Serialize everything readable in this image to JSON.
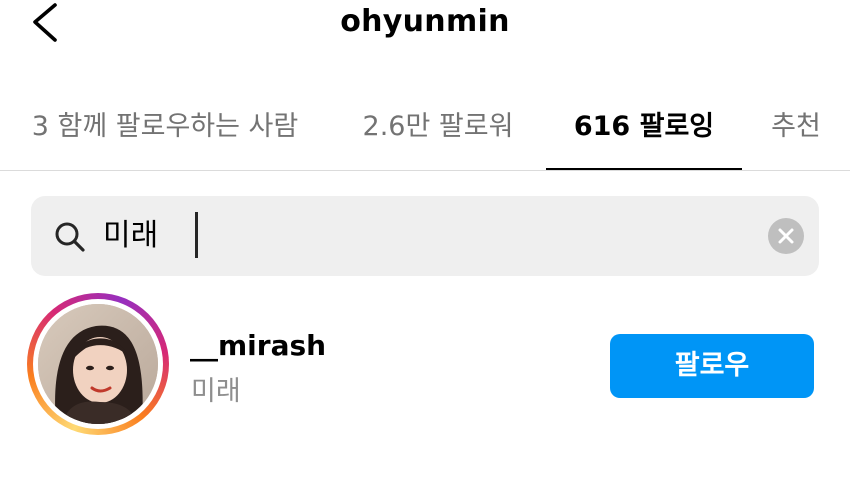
{
  "header": {
    "title": "ohyunmin",
    "back_icon": "chevron-left-icon"
  },
  "tabs": [
    {
      "label": "3 함께 팔로우하는 사람",
      "active": false
    },
    {
      "label": "2.6만 팔로워",
      "active": false
    },
    {
      "label": "616 팔로잉",
      "active": true
    },
    {
      "label": "추천",
      "active": false
    }
  ],
  "search": {
    "value": "미래",
    "icon": "search-icon",
    "clear_icon": "clear-icon"
  },
  "results": [
    {
      "username": "__mirash",
      "full_name": "미래",
      "action_label": "팔로우",
      "has_story": true
    }
  ],
  "colors": {
    "accent": "#0095f6",
    "tab_active": "#000000",
    "tab_inactive": "#737373",
    "secondary_text": "#8e8e8e",
    "search_bg": "#efefef"
  }
}
